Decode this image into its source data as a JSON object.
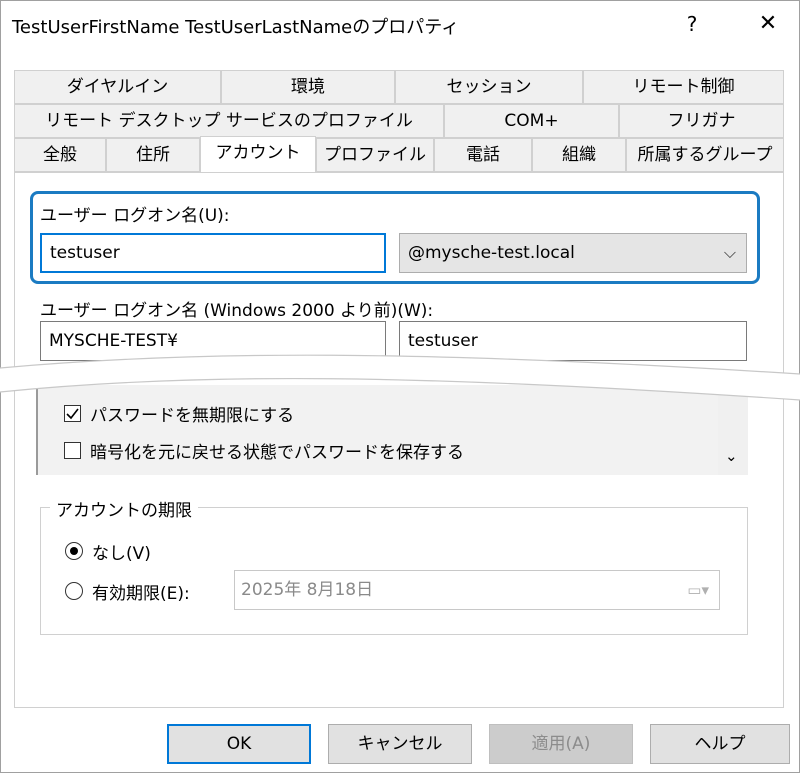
{
  "window": {
    "title": "TestUserFirstName TestUserLastNameのプロパティ",
    "help": "?",
    "close": "✕"
  },
  "tabs": {
    "row1": [
      "ダイヤルイン",
      "環境",
      "セッション",
      "リモート制御"
    ],
    "row2": [
      "リモート デスクトップ サービスのプロファイル",
      "COM+",
      "フリガナ"
    ],
    "row3": [
      "全般",
      "住所",
      "アカウント",
      "プロファイル",
      "電話",
      "組織",
      "所属するグループ"
    ],
    "active": "アカウント"
  },
  "logon": {
    "label": "ユーザー ログオン名(U):",
    "value": "testuser",
    "domain": "@mysche-test.local",
    "pre2000_label": "ユーザー ログオン名 (Windows 2000 より前)(W):",
    "pre2000_domain": "MYSCHE-TEST¥",
    "pre2000_value": "testuser"
  },
  "options": [
    {
      "label": "パスワードを無期限にする",
      "checked": true
    },
    {
      "label": "暗号化を元に戻せる状態でパスワードを保存する",
      "checked": false
    }
  ],
  "expiry": {
    "group_title": "アカウントの期限",
    "never_label": "なし(V)",
    "end_label": "有効期限(E):",
    "date_value": "2025年  8月18日",
    "selected": "never"
  },
  "buttons": {
    "ok": "OK",
    "cancel": "キャンセル",
    "apply": "適用(A)",
    "help": "ヘルプ"
  }
}
